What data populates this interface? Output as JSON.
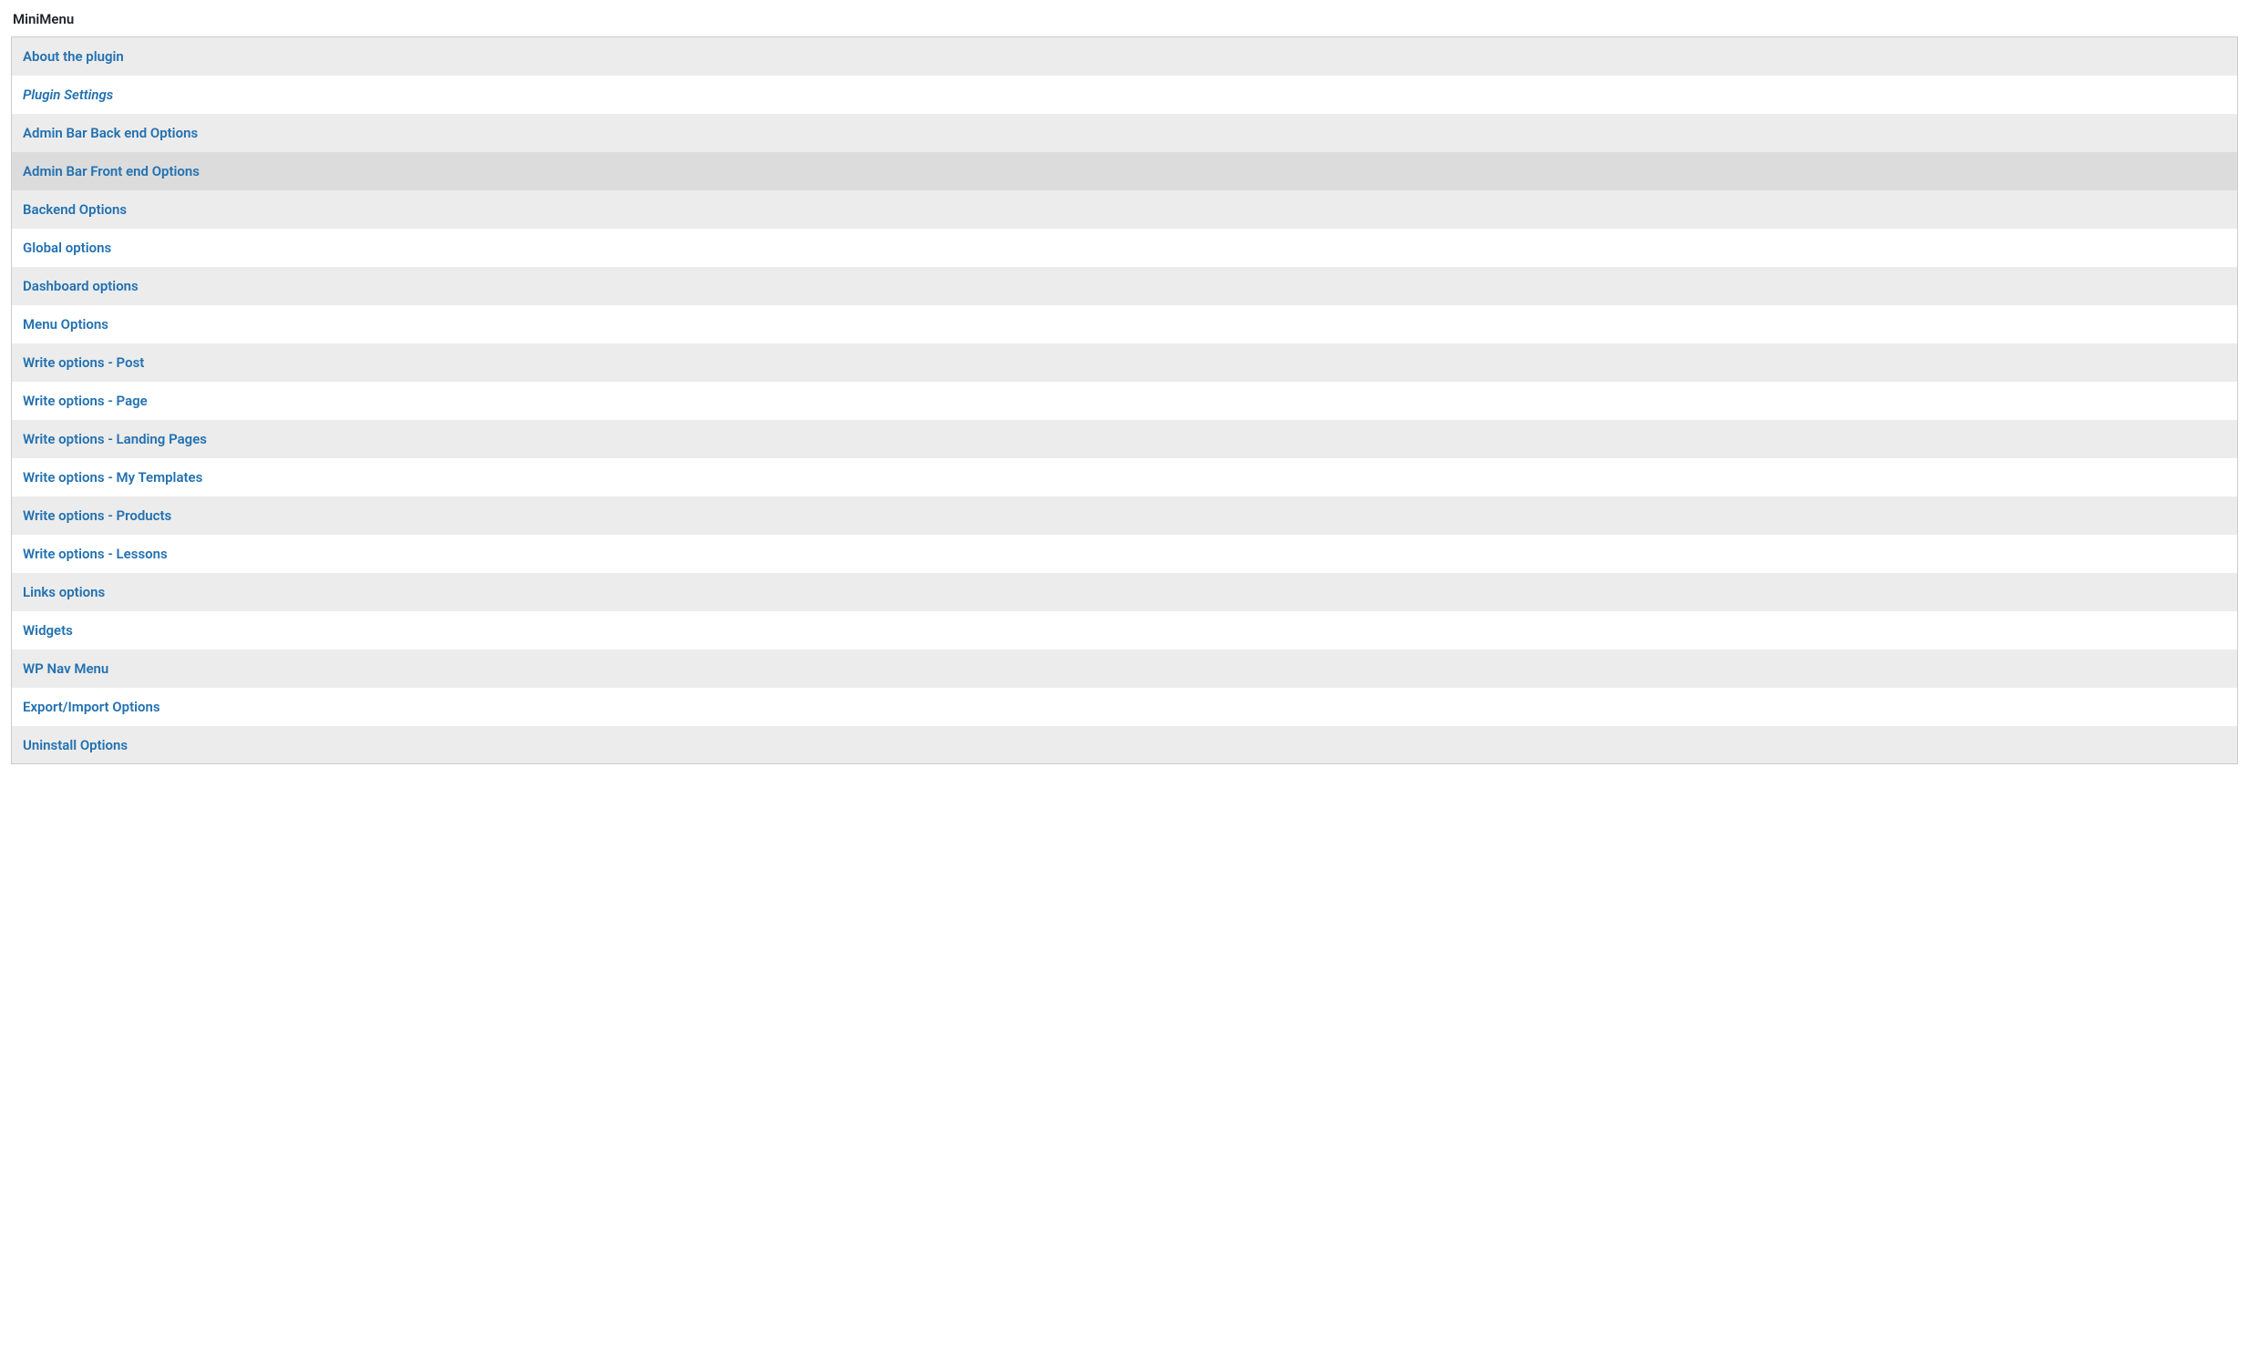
{
  "title": "MiniMenu",
  "items": [
    {
      "label": "About the plugin",
      "italic": false,
      "hovered": false
    },
    {
      "label": "Plugin Settings",
      "italic": true,
      "hovered": false
    },
    {
      "label": "Admin Bar Back end Options",
      "italic": false,
      "hovered": false
    },
    {
      "label": "Admin Bar Front end Options",
      "italic": false,
      "hovered": true
    },
    {
      "label": "Backend Options",
      "italic": false,
      "hovered": false
    },
    {
      "label": "Global options",
      "italic": false,
      "hovered": false
    },
    {
      "label": "Dashboard options",
      "italic": false,
      "hovered": false
    },
    {
      "label": "Menu Options",
      "italic": false,
      "hovered": false
    },
    {
      "label": "Write options - Post",
      "italic": false,
      "hovered": false
    },
    {
      "label": "Write options - Page",
      "italic": false,
      "hovered": false
    },
    {
      "label": "Write options - Landing Pages",
      "italic": false,
      "hovered": false
    },
    {
      "label": "Write options - My Templates",
      "italic": false,
      "hovered": false
    },
    {
      "label": "Write options - Products",
      "italic": false,
      "hovered": false
    },
    {
      "label": "Write options - Lessons",
      "italic": false,
      "hovered": false
    },
    {
      "label": "Links options",
      "italic": false,
      "hovered": false
    },
    {
      "label": "Widgets",
      "italic": false,
      "hovered": false
    },
    {
      "label": "WP Nav Menu",
      "italic": false,
      "hovered": false
    },
    {
      "label": "Export/Import Options",
      "italic": false,
      "hovered": false
    },
    {
      "label": "Uninstall Options",
      "italic": false,
      "hovered": false
    }
  ]
}
